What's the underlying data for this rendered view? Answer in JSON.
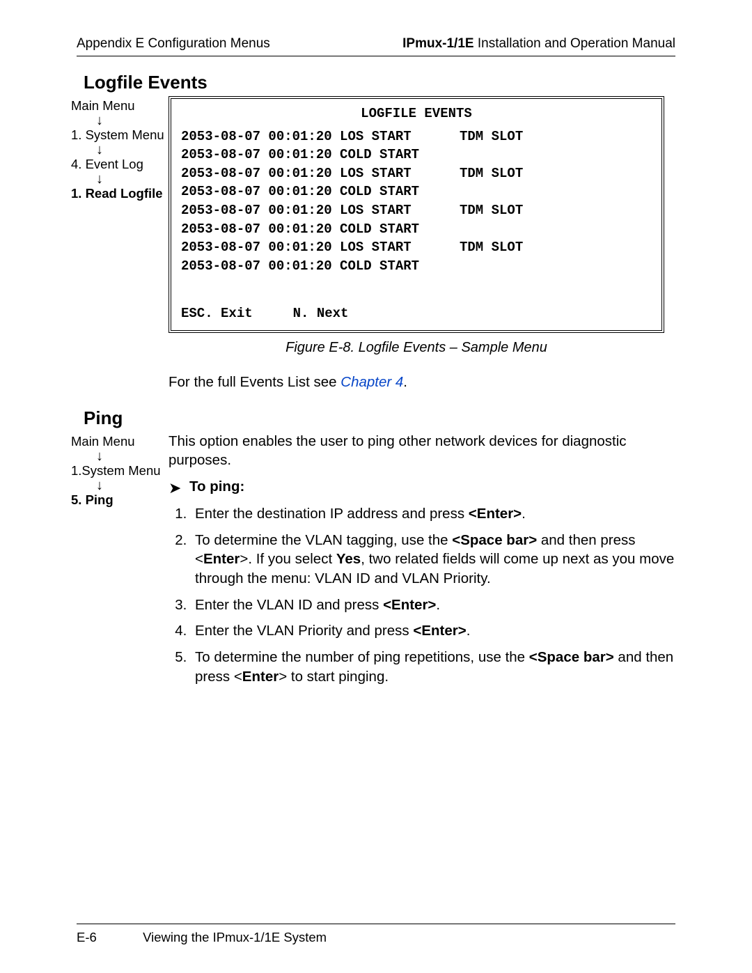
{
  "header": {
    "left": "Appendix E  Configuration Menus",
    "right_bold": "IPmux-1/1E",
    "right_rest": " Installation and Operation Manual"
  },
  "logfile": {
    "title": "Logfile Events",
    "crumbs": [
      "Main Menu",
      "1. System Menu",
      "4. Event Log",
      "1. Read Logfile"
    ],
    "terminal": {
      "title": "LOGFILE EVENTS",
      "rows": [
        {
          "c1": "2053-08-07 00:01:20 LOS START",
          "c2": "TDM SLOT"
        },
        {
          "c1": "2053-08-07 00:01:20 COLD START",
          "c2": ""
        },
        {
          "c1": "2053-08-07 00:01:20 LOS START",
          "c2": "TDM SLOT"
        },
        {
          "c1": "2053-08-07 00:01:20 COLD START",
          "c2": ""
        },
        {
          "c1": "2053-08-07 00:01:20 LOS START",
          "c2": "TDM SLOT"
        },
        {
          "c1": "2053-08-07 00:01:20 COLD START",
          "c2": ""
        },
        {
          "c1": "2053-08-07 00:01:20 LOS START",
          "c2": "TDM SLOT"
        },
        {
          "c1": "2053-08-07 00:01:20 COLD START",
          "c2": ""
        }
      ],
      "footer_left": "ESC. Exit",
      "footer_right": "N. Next"
    },
    "caption": "Figure E-8.  Logfile Events – Sample Menu",
    "after_text_a": "For the full Events List see ",
    "after_link": "Chapter 4",
    "after_text_b": "."
  },
  "ping": {
    "title": "Ping",
    "crumbs": [
      "Main Menu",
      "1.System Menu",
      "5. Ping"
    ],
    "intro": "This option enables the user to ping other network devices for diagnostic purposes.",
    "to_ping": "To ping:",
    "steps": {
      "s1a": "Enter the destination IP address and press ",
      "s1b": "<Enter>",
      "s1c": ".",
      "s2a": "To determine the VLAN tagging, use the ",
      "s2b": "<Space bar>",
      "s2c": " and then press <",
      "s2d": "Enter",
      "s2e": ">. If you select ",
      "s2f": "Yes",
      "s2g": ", two related fields will come up next as you move through the menu: VLAN ID and VLAN Priority.",
      "s3a": "Enter the VLAN ID and press ",
      "s3b": "<Enter>",
      "s3c": ".",
      "s4a": "Enter the VLAN Priority and press ",
      "s4b": "<Enter>",
      "s4c": ".",
      "s5a": "To determine the number of ping repetitions, use the ",
      "s5b": "<Space bar>",
      "s5c": " and then press <",
      "s5d": "Enter",
      "s5e": "> to start pinging."
    }
  },
  "footer": {
    "page": "E-6",
    "text": "Viewing the IPmux-1/1E System"
  }
}
